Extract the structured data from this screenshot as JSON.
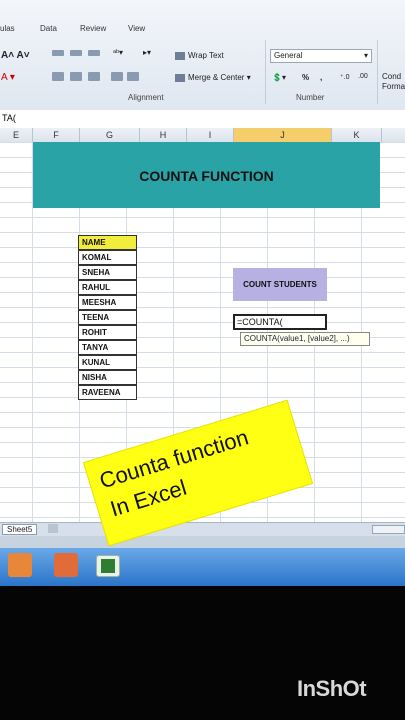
{
  "ribbon": {
    "tabs": [
      "ulas",
      "Data",
      "Review",
      "View"
    ],
    "wrap_text": "Wrap Text",
    "merge_center": "Merge & Center",
    "number_format": "General",
    "alignment_label": "Alignment",
    "number_label": "Number",
    "cond_format_1": "Cond",
    "cond_format_2": "Forma",
    "percent": "%",
    "comma": ","
  },
  "formula_bar": {
    "content": "TA("
  },
  "columns": [
    "E",
    "F",
    "G",
    "H",
    "I",
    "J",
    "K"
  ],
  "sheet": {
    "title": "COUNTA FUNCTION",
    "names": [
      "NAME",
      "KOMAL",
      "SNEHA",
      "RAHUL",
      "MEESHA",
      "TEENA",
      "ROHIT",
      "TANYA",
      "KUNAL",
      "NISHA",
      "RAVEENA"
    ],
    "count_label": "COUNT STUDENTS",
    "formula_input": "=COUNTA(",
    "tooltip": "COUNTA(value1, [value2], ...)"
  },
  "overlay": {
    "line1": "Counta function",
    "line2": "In Excel"
  },
  "sheet_tab": "Sheet5",
  "watermark": "InShOt"
}
